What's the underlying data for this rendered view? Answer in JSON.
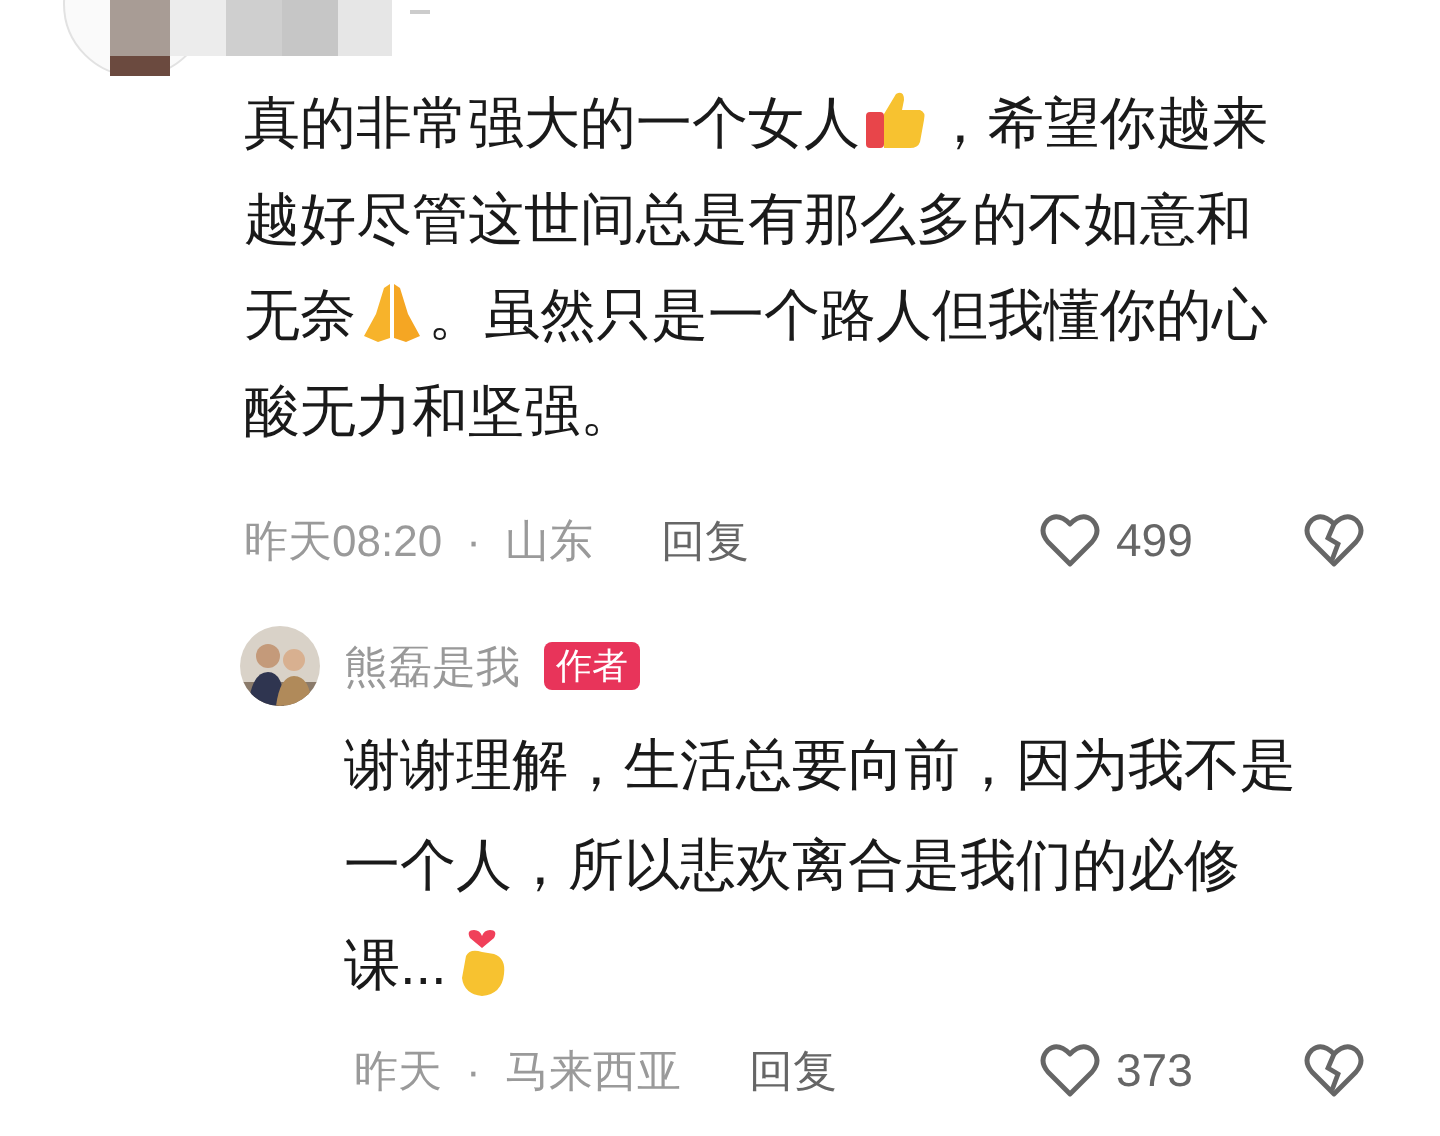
{
  "comment": {
    "lines": [
      [
        {
          "kind": "text",
          "text": "真的非常强大的一个女人"
        },
        {
          "kind": "thumbs-up"
        },
        {
          "kind": "text",
          "text": "，希望你越来"
        }
      ],
      [
        {
          "kind": "text",
          "text": "越好尽管这世间总是有那么多的不如意和"
        }
      ],
      [
        {
          "kind": "text",
          "text": "无奈"
        },
        {
          "kind": "praying-hands"
        },
        {
          "kind": "text",
          "text": "。虽然只是一个路人但我懂你的心"
        }
      ],
      [
        {
          "kind": "text",
          "text": "酸无力和坚强。"
        }
      ]
    ],
    "time": "昨天08:20",
    "separator": "·",
    "location": "山东",
    "reply_label": "回复",
    "likes": "499"
  },
  "reply": {
    "author": "熊磊是我",
    "badge": "作者",
    "lines": [
      [
        {
          "kind": "text",
          "text": "谢谢理解，生活总要向前，因为我不是"
        }
      ],
      [
        {
          "kind": "text",
          "text": "一个人，所以悲欢离合是我们的必修"
        }
      ],
      [
        {
          "kind": "text",
          "text": "课..."
        },
        {
          "kind": "finger-heart"
        }
      ]
    ],
    "time": "昨天",
    "separator": "·",
    "location": "马来西亚",
    "reply_label": "回复",
    "likes": "373"
  }
}
